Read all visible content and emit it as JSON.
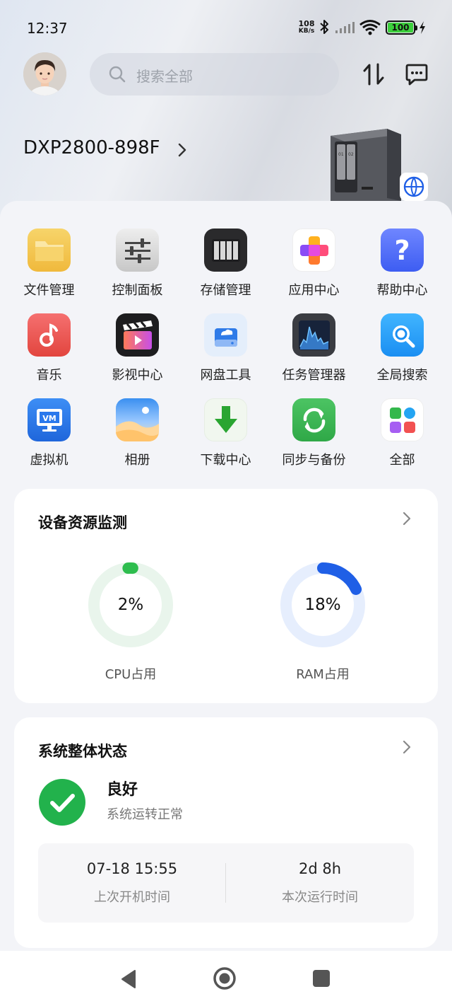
{
  "status_bar": {
    "time": "12:37",
    "net_speed_value": "108",
    "net_speed_unit": "KB/s",
    "battery": "100",
    "icons": [
      "bluetooth-icon",
      "signal-icon",
      "wifi-icon",
      "battery-icon",
      "charging-icon"
    ]
  },
  "header": {
    "search_placeholder": "搜索全部"
  },
  "device": {
    "name": "DXP2800-898F"
  },
  "apps": [
    {
      "label": "文件管理",
      "icon": "folder-icon"
    },
    {
      "label": "控制面板",
      "icon": "sliders-icon"
    },
    {
      "label": "存储管理",
      "icon": "storage-icon"
    },
    {
      "label": "应用中心",
      "icon": "app-center-icon"
    },
    {
      "label": "帮助中心",
      "icon": "help-icon"
    },
    {
      "label": "音乐",
      "icon": "music-icon"
    },
    {
      "label": "影视中心",
      "icon": "video-icon"
    },
    {
      "label": "网盘工具",
      "icon": "cloud-drive-icon"
    },
    {
      "label": "任务管理器",
      "icon": "task-manager-icon"
    },
    {
      "label": "全局搜索",
      "icon": "global-search-icon"
    },
    {
      "label": "虚拟机",
      "icon": "vm-icon"
    },
    {
      "label": "相册",
      "icon": "photos-icon"
    },
    {
      "label": "下载中心",
      "icon": "download-icon"
    },
    {
      "label": "同步与备份",
      "icon": "sync-icon"
    },
    {
      "label": "全部",
      "icon": "all-apps-icon"
    }
  ],
  "monitor": {
    "title": "设备资源监测",
    "cpu": {
      "value": "2%",
      "label": "CPU占用",
      "fraction": 0.02,
      "color": "#2ebd4e",
      "track": "#e9f5ec"
    },
    "ram": {
      "value": "18%",
      "label": "RAM占用",
      "fraction": 0.18,
      "color": "#1f5fe6",
      "track": "#e6eefd"
    }
  },
  "system": {
    "title": "系统整体状态",
    "status": "良好",
    "status_sub": "系统运转正常",
    "boot_time": "07-18 15:55",
    "boot_time_label": "上次开机时间",
    "uptime": "2d 8h",
    "uptime_label": "本次运行时间"
  },
  "nav": [
    "back-button",
    "home-button",
    "recents-button"
  ]
}
